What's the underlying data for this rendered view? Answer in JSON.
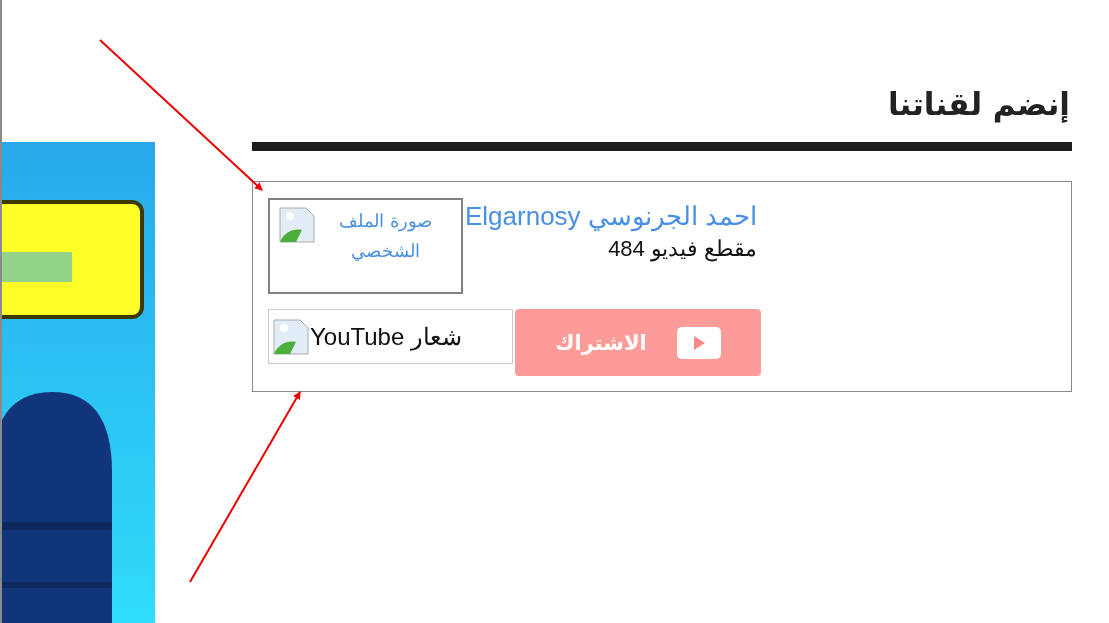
{
  "widget": {
    "title": "إنضم لقناتنا",
    "profile_image": {
      "alt": "صورة الملف الشخصي"
    },
    "channel_name": "احمد الجرنوسي Elgarnosy",
    "video_count": "مقطع فيديو 484",
    "logo_image": {
      "alt": "شعار YouTube"
    },
    "subscribe_button": {
      "label": "الاشتراك"
    }
  }
}
